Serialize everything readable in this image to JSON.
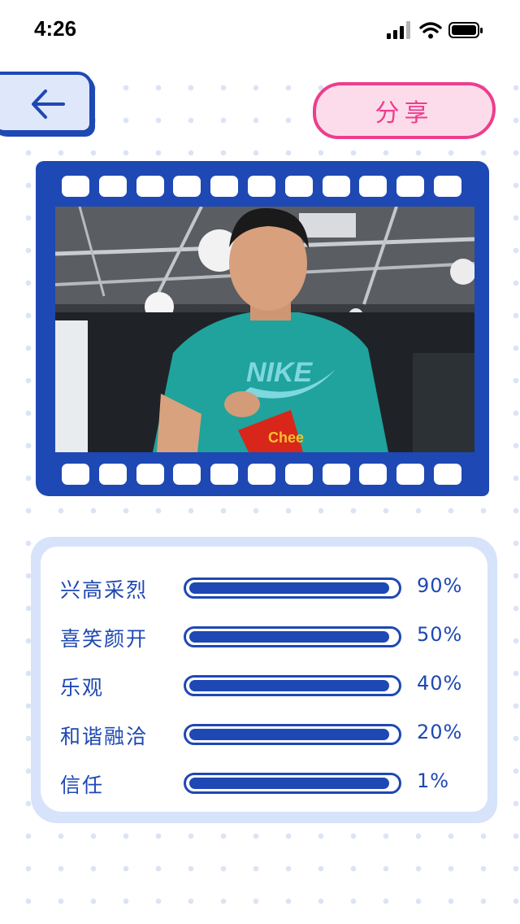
{
  "status_bar": {
    "time": "4:26"
  },
  "header": {
    "back_icon": "arrow-left-icon",
    "share_label": "分享"
  },
  "photo": {
    "description_icon": "photo"
  },
  "emotions": [
    {
      "label": "兴高采烈",
      "value": "90%",
      "fill": 0.97
    },
    {
      "label": "喜笑颜开",
      "value": "50%",
      "fill": 0.97
    },
    {
      "label": "乐观",
      "value": "40%",
      "fill": 0.97
    },
    {
      "label": "和谐融洽",
      "value": "20%",
      "fill": 0.97
    },
    {
      "label": "信任",
      "value": "1%",
      "fill": 0.97
    }
  ],
  "colors": {
    "primary": "#1e48b4",
    "accent_pink": "#ee3d8e",
    "panel_bg": "#d7e3fb",
    "share_bg": "#fcdcea"
  }
}
